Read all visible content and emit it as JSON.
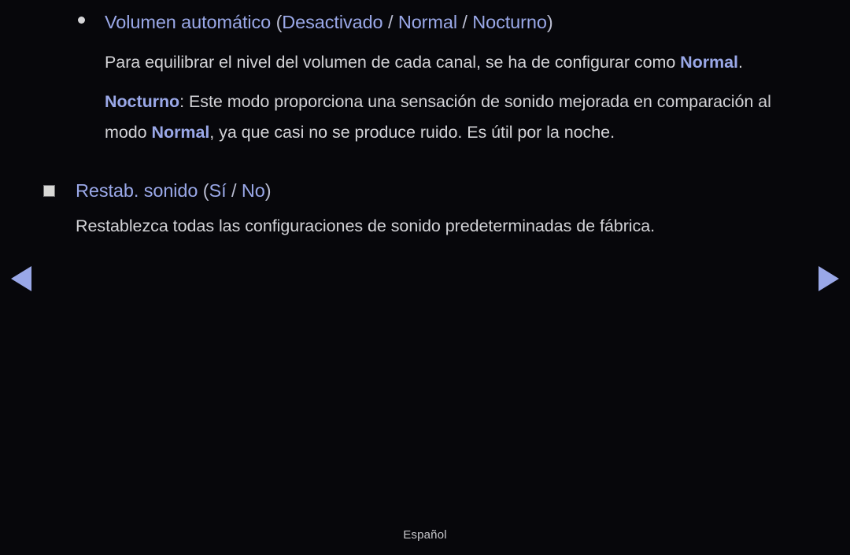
{
  "background_color": "#07070b",
  "accent_color": "#9aa8e8",
  "body_text_color": "#d2d2d6",
  "entry": {
    "bullet": "dot-bullet",
    "title": {
      "name": "Volumen automático",
      "open_paren": " (",
      "option_1": "Desactivado",
      "sep_1": " / ",
      "option_2": "Normal",
      "sep_2": " / ",
      "option_3": "Nocturno",
      "close_paren": ")"
    },
    "paragraph_1": {
      "text_before": "Para equilibrar el nivel del volumen de cada canal, se ha de configurar como ",
      "keyword": "Normal",
      "text_after": "."
    },
    "paragraph_2": {
      "keyword_1": "Nocturno",
      "text_1": ": Este modo proporciona una sensación de sonido mejorada en comparación al modo ",
      "keyword_2": "Normal",
      "text_2": ", ya que casi no se produce ruido. Es útil por la noche."
    }
  },
  "section": {
    "bullet": "square-bullet",
    "title": {
      "name": "Restab. sonido",
      "open_paren": " (",
      "option_1": "Sí",
      "sep_1": " / ",
      "option_2": "No",
      "close_paren": ")"
    },
    "description": "Restablezca todas las configuraciones de sonido predeterminadas de fábrica."
  },
  "navigation": {
    "prev_icon": "triangle-left-icon",
    "next_icon": "triangle-right-icon"
  },
  "footer": {
    "language": "Español"
  }
}
